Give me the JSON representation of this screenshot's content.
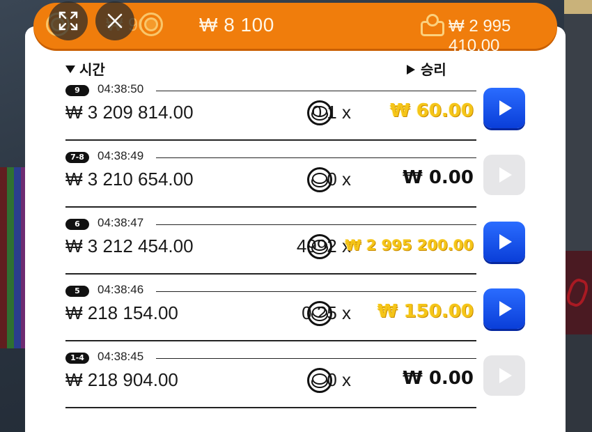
{
  "header": {
    "bet_previous": "₩ 900",
    "bet_current": "₩ 8 100",
    "balance": "₩ 2 995 410.00"
  },
  "columns": {
    "time": "시간",
    "win": "승리"
  },
  "rows": [
    {
      "badge": "9",
      "time": "04:38:50",
      "amount": "₩ 3 209 814.00",
      "multiplier": "0.1 x",
      "win": "₩ 60.00",
      "win_style": "gold",
      "play_enabled": true
    },
    {
      "badge": "7-8",
      "time": "04:38:49",
      "amount": "₩ 3 210 654.00",
      "multiplier": "0 x",
      "win": "₩ 0.00",
      "win_style": "black",
      "play_enabled": false
    },
    {
      "badge": "6",
      "time": "04:38:47",
      "amount": "₩ 3 212 454.00",
      "multiplier": "4992 x",
      "win": "₩ 2 995 200.00",
      "win_style": "gold",
      "play_enabled": true
    },
    {
      "badge": "5",
      "time": "04:38:46",
      "amount": "₩ 218 154.00",
      "multiplier": "0.25 x",
      "win": "₩ 150.00",
      "win_style": "gold",
      "play_enabled": true
    },
    {
      "badge": "1-4",
      "time": "04:38:45",
      "amount": "₩ 218 904.00",
      "multiplier": "0 x",
      "win": "₩ 0.00",
      "win_style": "black",
      "play_enabled": false
    }
  ],
  "icons": {
    "fullscreen": "expand-icon",
    "close": "close-icon",
    "coin": "coin-icon",
    "wallet": "wallet-icon",
    "play": "play-icon"
  },
  "colors": {
    "topbar": "#f07d0c",
    "play_active": "#1a55f0",
    "play_disabled": "#e6e6e8",
    "win_gold": "#f5c518"
  }
}
